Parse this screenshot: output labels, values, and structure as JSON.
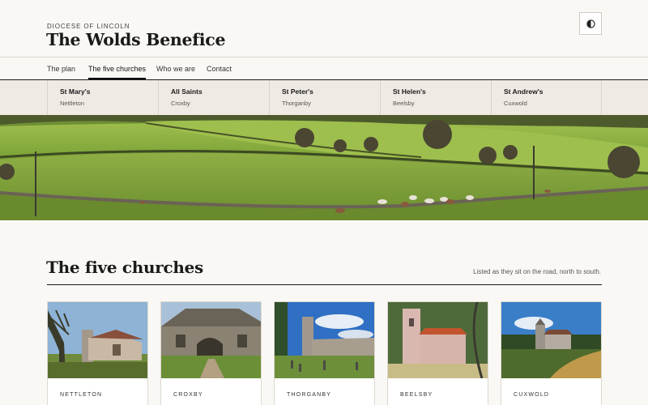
{
  "header": {
    "eyebrow": "DIOCESE OF LINCOLN",
    "title": "The Wolds Benefice",
    "theme_toggle_icon": "contrast-icon"
  },
  "nav": {
    "items": [
      {
        "label": "The plan",
        "active": false
      },
      {
        "label": "The five churches",
        "active": true
      },
      {
        "label": "Who we are",
        "active": false
      },
      {
        "label": "Contact",
        "active": false
      }
    ]
  },
  "church_strip": [
    {
      "name": "St Mary's",
      "place": "Nettleton"
    },
    {
      "name": "All Saints",
      "place": "Croxby"
    },
    {
      "name": "St Peter's",
      "place": "Thorganby"
    },
    {
      "name": "St Helen's",
      "place": "Beelsby"
    },
    {
      "name": "St Andrew's",
      "place": "Cuxwold"
    }
  ],
  "section": {
    "title": "The five churches",
    "note": "Listed as they sit on the road, north to south."
  },
  "cards": [
    {
      "label": "NETTLETON"
    },
    {
      "label": "CROXBY"
    },
    {
      "label": "THORGANBY"
    },
    {
      "label": "BEELSBY"
    },
    {
      "label": "CUXWOLD"
    }
  ],
  "colors": {
    "background": "#faf8f5",
    "strip": "#efebe4",
    "ink": "#1a1a1a",
    "field_green": "#7fa23a"
  }
}
